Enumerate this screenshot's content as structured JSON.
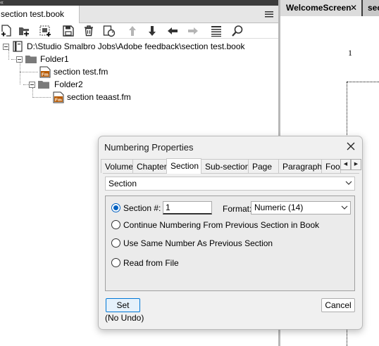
{
  "book_panel": {
    "tab_title": "section test.book",
    "toolbar_icons": [
      "add-file-icon",
      "add-folder-icon",
      "add-group-icon",
      "save-icon",
      "delete-icon",
      "update-book-icon",
      "move-up-icon",
      "move-down-icon",
      "move-left-icon",
      "move-right-icon",
      "properties-icon",
      "search-icon"
    ],
    "tree": {
      "root": "D:\\Studio Smalbro Jobs\\Adobe feedback\\section test.book",
      "folder1": "Folder1",
      "folder1_file": "section test.fm",
      "folder2": "Folder2",
      "folder2_file": "section teaast.fm",
      "file_badge": "Fm"
    }
  },
  "document_area": {
    "tabs": [
      {
        "label": "WelcomeScreen",
        "close": "✕"
      },
      {
        "label": "sec"
      }
    ],
    "page_number": "1"
  },
  "dialog": {
    "title": "Numbering Properties",
    "tabs": [
      "Volume",
      "Chapter",
      "Section",
      "Sub-section",
      "Page",
      "Paragraph",
      "Foo"
    ],
    "active_tab": "Section",
    "category": "Section",
    "options": {
      "section_number_label": "Section #:",
      "section_number_value": "1",
      "format_label": "Format:",
      "format_value": "Numeric  (14)",
      "continue_label": "Continue Numbering From Previous Section in Book",
      "same_number_label": "Use Same Number As Previous Section",
      "read_from_file_label": "Read from File",
      "selected": "section_number"
    },
    "set_label": "Set",
    "no_undo": "(No Undo)",
    "cancel_label": "Cancel"
  },
  "colors": {
    "accent": "#0060c0",
    "panel_dark": "#3c3c3c",
    "folder": "#7a7a7a",
    "fm_badge": "#b85a00"
  }
}
